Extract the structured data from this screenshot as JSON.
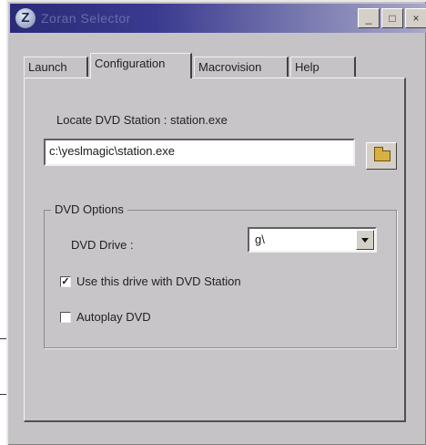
{
  "window": {
    "title": "Zoran Selector",
    "minimize_glyph": "_",
    "maximize_glyph": "□",
    "close_glyph": "×"
  },
  "tabs": [
    {
      "label": "Launch",
      "active": false
    },
    {
      "label": "Configuration",
      "active": true
    },
    {
      "label": "Macrovision",
      "active": false
    },
    {
      "label": "Help",
      "active": false
    }
  ],
  "config": {
    "locate_label": "Locate DVD Station : station.exe",
    "path_value": "c:\\yeslmagic\\station.exe",
    "browse_icon": "folder-open-icon"
  },
  "dvd_options": {
    "group_title": "DVD Options",
    "drive_label": "DVD Drive :",
    "drive_value": "g\\",
    "use_drive": {
      "label": "Use this drive with DVD Station",
      "checked": true
    },
    "autoplay": {
      "label": "Autoplay DVD",
      "checked": false
    }
  }
}
